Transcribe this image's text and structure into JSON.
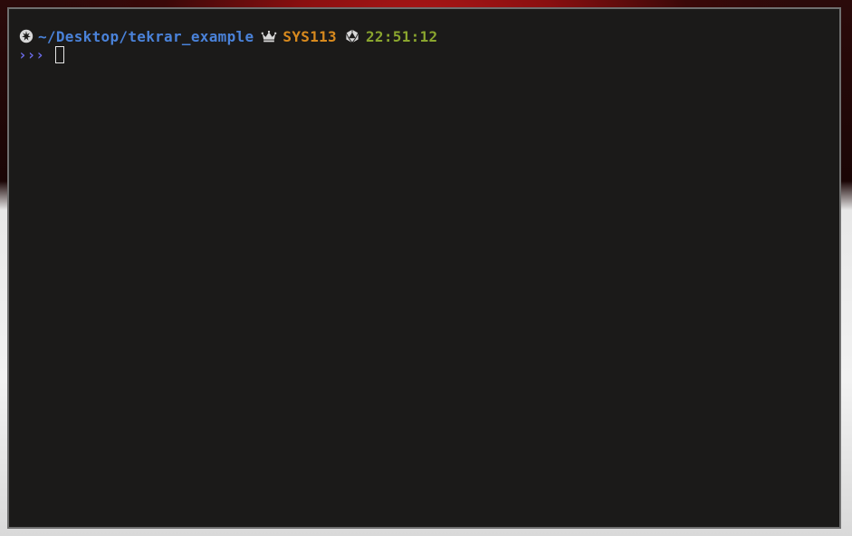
{
  "terminal": {
    "prompt": {
      "path": "~/Desktop/tekrar_example",
      "host": "SYS113",
      "time": "22:51:12",
      "icons": [
        "rebel-alliance-icon",
        "crown-icon",
        "d20-dice-icon"
      ]
    },
    "input": {
      "prompt_symbol": "›››",
      "value": ""
    }
  },
  "colors": {
    "terminal_bg": "#1b1a19",
    "path": "#4a82d9",
    "host": "#d88a1e",
    "time": "#8aa52e",
    "prompt_symbol": "#6b6be8"
  }
}
